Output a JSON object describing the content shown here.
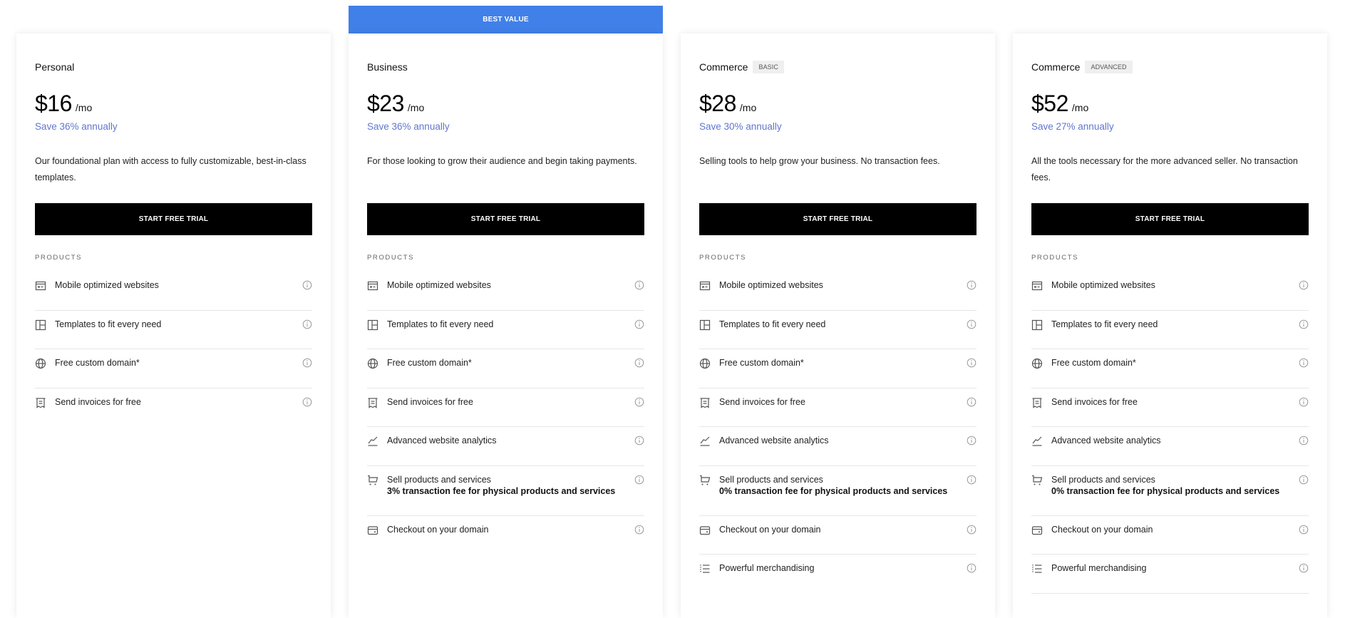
{
  "banner": {
    "label": "BEST VALUE",
    "color": "#4180e8"
  },
  "accent": {
    "save_color": "#6076d0",
    "cta_bg": "#000000"
  },
  "plans": [
    {
      "name": "Personal",
      "tag": null,
      "price": "$16",
      "period": "/mo",
      "save": "Save 36% annually",
      "description": "Our foundational plan with access to fully customizable, best-in-class templates.",
      "cta": "START FREE TRIAL",
      "section": "PRODUCTS",
      "features": [
        {
          "icon": "website-icon",
          "label": "Mobile optimized websites"
        },
        {
          "icon": "templates-icon",
          "label": "Templates to fit every need"
        },
        {
          "icon": "globe-icon",
          "label": "Free custom domain*"
        },
        {
          "icon": "invoice-icon",
          "label": "Send invoices for free"
        }
      ]
    },
    {
      "name": "Business",
      "tag": null,
      "price": "$23",
      "period": "/mo",
      "save": "Save 36% annually",
      "description": "For those looking to grow their audience and begin taking payments.",
      "cta": "START FREE TRIAL",
      "section": "PRODUCTS",
      "features": [
        {
          "icon": "website-icon",
          "label": "Mobile optimized websites"
        },
        {
          "icon": "templates-icon",
          "label": "Templates to fit every need"
        },
        {
          "icon": "globe-icon",
          "label": "Free custom domain*"
        },
        {
          "icon": "invoice-icon",
          "label": "Send invoices for free"
        },
        {
          "icon": "analytics-icon",
          "label": "Advanced website analytics"
        },
        {
          "icon": "cart-icon",
          "label": "Sell products and services",
          "sub": "3% transaction fee for physical products and services"
        },
        {
          "icon": "card-icon",
          "label": "Checkout on your domain"
        }
      ]
    },
    {
      "name": "Commerce",
      "tag": "BASIC",
      "price": "$28",
      "period": "/mo",
      "save": "Save 30% annually",
      "description": "Selling tools to help grow your business. No transaction fees.",
      "cta": "START FREE TRIAL",
      "section": "PRODUCTS",
      "features": [
        {
          "icon": "website-icon",
          "label": "Mobile optimized websites"
        },
        {
          "icon": "templates-icon",
          "label": "Templates to fit every need"
        },
        {
          "icon": "globe-icon",
          "label": "Free custom domain*"
        },
        {
          "icon": "invoice-icon",
          "label": "Send invoices for free"
        },
        {
          "icon": "analytics-icon",
          "label": "Advanced website analytics"
        },
        {
          "icon": "cart-icon",
          "label": "Sell products and services",
          "sub": "0% transaction fee for physical products and services"
        },
        {
          "icon": "card-icon",
          "label": "Checkout on your domain"
        },
        {
          "icon": "merchandising-icon",
          "label": "Powerful merchandising"
        }
      ]
    },
    {
      "name": "Commerce",
      "tag": "ADVANCED",
      "price": "$52",
      "period": "/mo",
      "save": "Save 27% annually",
      "description": "All the tools necessary for the more advanced seller. No transaction fees.",
      "cta": "START FREE TRIAL",
      "section": "PRODUCTS",
      "features": [
        {
          "icon": "website-icon",
          "label": "Mobile optimized websites"
        },
        {
          "icon": "templates-icon",
          "label": "Templates to fit every need"
        },
        {
          "icon": "globe-icon",
          "label": "Free custom domain*"
        },
        {
          "icon": "invoice-icon",
          "label": "Send invoices for free"
        },
        {
          "icon": "analytics-icon",
          "label": "Advanced website analytics"
        },
        {
          "icon": "cart-icon",
          "label": "Sell products and services",
          "sub": "0% transaction fee for physical products and services"
        },
        {
          "icon": "card-icon",
          "label": "Checkout on your domain"
        },
        {
          "icon": "merchandising-icon",
          "label": "Powerful merchandising"
        }
      ]
    }
  ]
}
